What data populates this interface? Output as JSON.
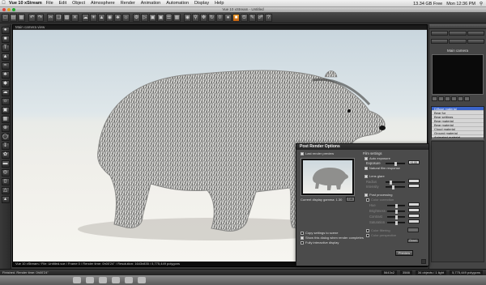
{
  "menubar": {
    "app_name": "Vue 10 xStream",
    "items": [
      "File",
      "Edit",
      "Object",
      "Atmosphere",
      "Render",
      "Animation",
      "Automation",
      "Display",
      "Help"
    ],
    "free_space": "13.34 GB Free",
    "clock": "Mon 12:36 PM"
  },
  "window": {
    "title": "Vue 10 xStream - Untitled"
  },
  "viewport": {
    "header": "Main camera view",
    "status": "Vue 10 xStream / File: Untitled.vue / Frame 0 / Render time: 0h00'24\" / Resolution: 1643x835 / 5,775,449 polygons"
  },
  "right_panel": {
    "camera_label": "Main camera",
    "materials": [
      "Diffuse material",
      "Bear fur",
      "Bear settings",
      "Bear material",
      "Bear material",
      "Cloud material",
      "Ground material",
      "Animated material"
    ]
  },
  "dialog": {
    "title": "Post Render Options",
    "last_render": "Last render preview",
    "film_settings": "Film settings",
    "auto_exposure": "Auto exposure",
    "exposure": "Exposure",
    "exposure_value": "+0.00",
    "natural_film": "Natural film response",
    "lens_glare": "Lens glare",
    "radius": "Radius",
    "intensity": "Intensity",
    "post_processing": "Post processing",
    "color_correction": "Color correction",
    "hue": "Hue",
    "brightness": "Brightness",
    "contrast": "Contrast",
    "saturation": "Saturation",
    "color_filtering": "Color filtering",
    "color_perspective": "Color perspective",
    "gamma": "Current display gamma: 1.30",
    "edit": "Edit",
    "copy_settings": "Copy settings to scene",
    "show_dialog": "Show this dialog when render completes",
    "fully_interactive": "Fully interactive display",
    "preview_button": "Preview",
    "reset": "Reset"
  },
  "statusbar": {
    "left": "Finished. Render time: 0h00'24\"",
    "right": [
      "5643x2",
      "3588",
      "34 objects / 1 light",
      "5,775,449 polygons"
    ]
  },
  "colors": {
    "accent": "#e88a20",
    "selection": "#3b64c8"
  }
}
